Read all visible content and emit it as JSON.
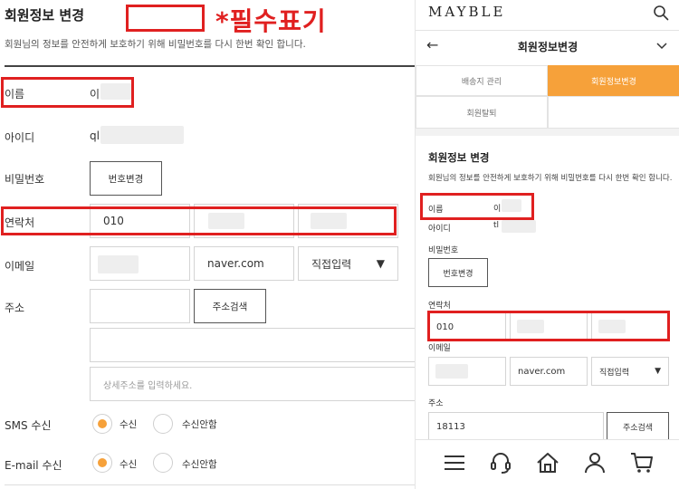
{
  "left": {
    "title": "회원정보 변경",
    "required_note": "*필수표기",
    "description": "회원님의 정보를 안전하게 보호하기 위해 비밀번호를 다시 한번 확인 합니다.",
    "name_label": "이름",
    "name_value": "이",
    "id_label": "아이디",
    "id_value": "ql",
    "password_label": "비밀번호",
    "password_button": "번호변경",
    "phone_label": "연락처",
    "phone_value_1": "010",
    "email_label": "이메일",
    "email_domain": "naver.com",
    "email_select": "직접입력",
    "select_arrow": "▼",
    "address_label": "주소",
    "address_search_button": "주소검색",
    "address_detail_placeholder": "상세주소를 입력하세요.",
    "sms_label": "SMS 수신",
    "email_receive_label": "E-mail 수신",
    "receive_yes": "수신",
    "receive_no": "수신안함",
    "accent_color": "#f6a13a",
    "highlight_color": "#e02020"
  },
  "right": {
    "logo": "MAYBLE",
    "back_arrow": "←",
    "page_title": "회원정보변경",
    "tabs": [
      "배송지 관리",
      "회원정보변경",
      "회원탈퇴"
    ],
    "active_tab": "회원정보변경",
    "title": "회원정보 변경",
    "description": "회원님의 정보를 안전하게 보호하기 위해 비밀번호를 다시 한번 확인 합니다.",
    "name_label": "이름",
    "name_value": "이",
    "id_label": "아이디",
    "id_value": "tl",
    "password_label": "비밀번호",
    "password_button": "번호변경",
    "phone_label": "연락처",
    "phone_value_1": "010",
    "email_label": "이메일",
    "email_domain": "naver.com",
    "email_select": "직접입력",
    "select_arrow": "▼",
    "address_label": "주소",
    "zipcode": "18113",
    "address_search_button": "주소검색",
    "bottom_icons": [
      "menu-icon",
      "headset-icon",
      "home-icon",
      "user-icon",
      "cart-icon"
    ]
  }
}
